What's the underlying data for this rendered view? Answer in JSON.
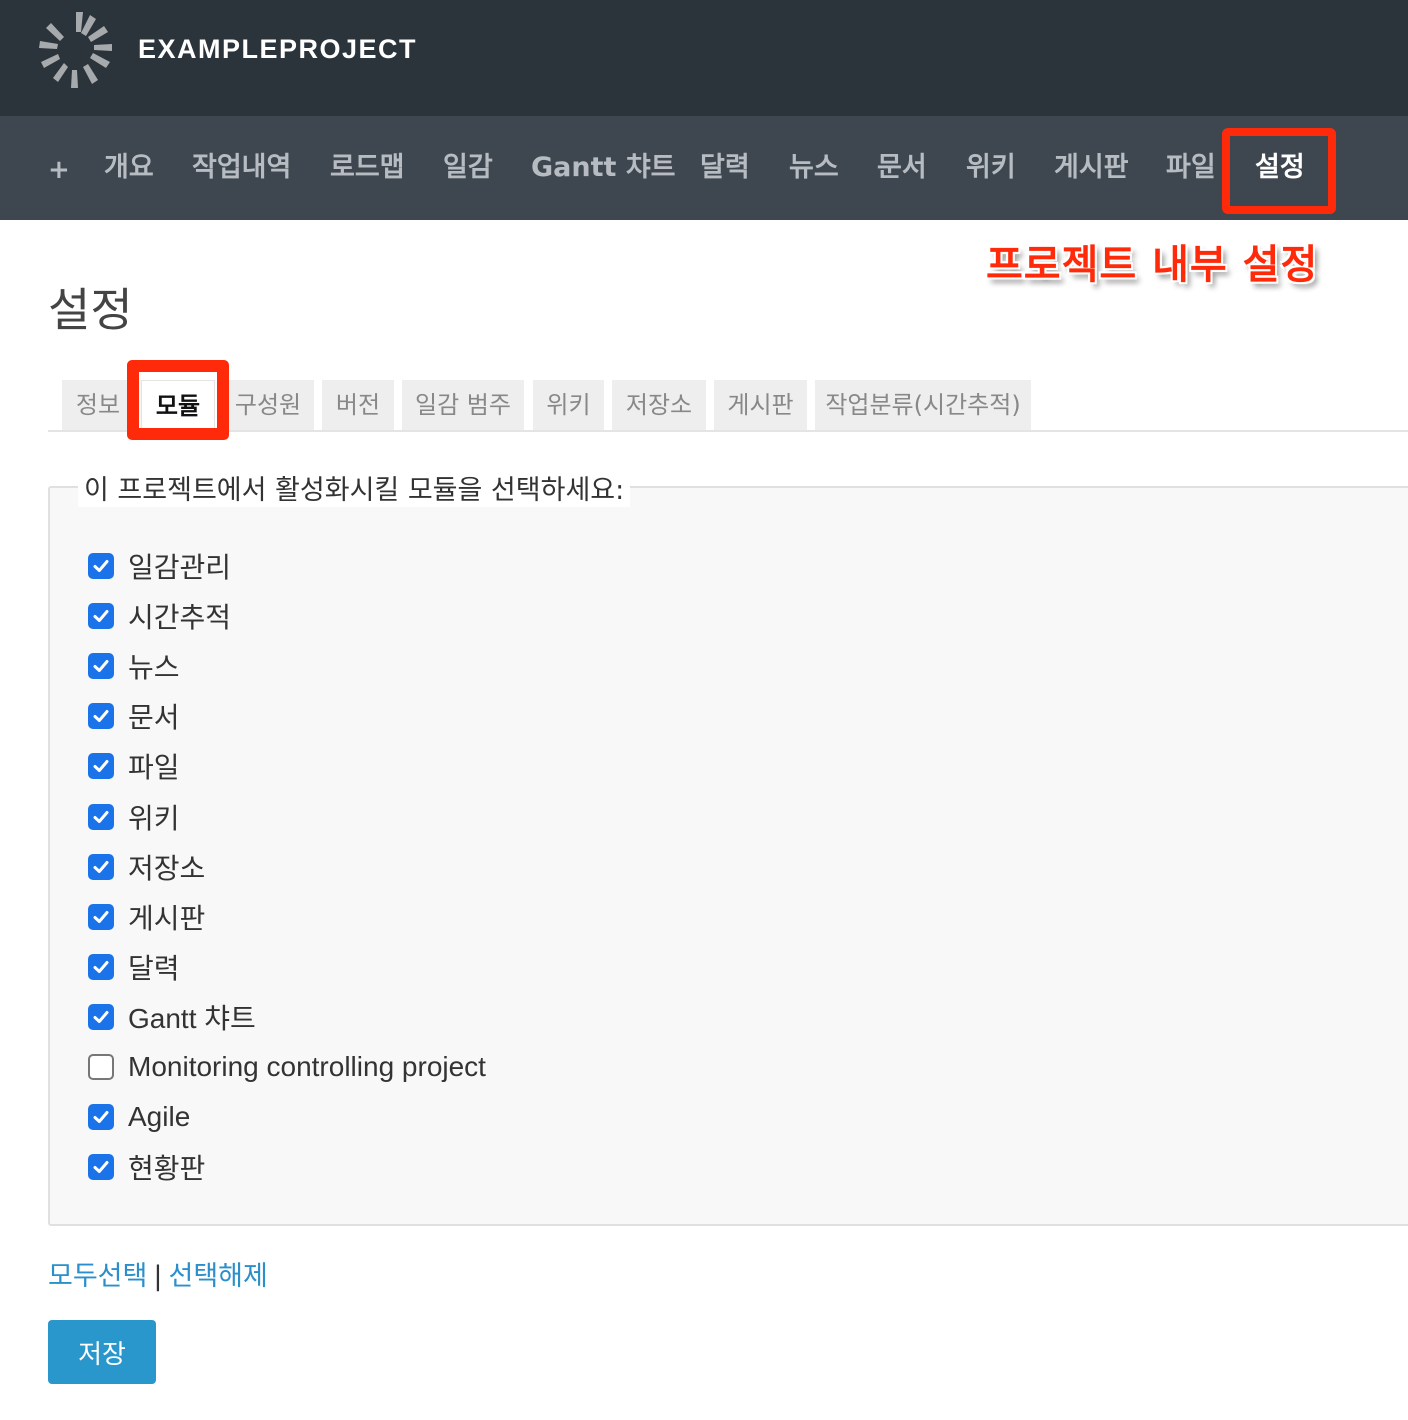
{
  "header": {
    "project_name": "EXAMPLEPROJECT",
    "logo_icon": "redmine-gear-logo-icon"
  },
  "main_menu": {
    "plus_label": "+",
    "items": [
      {
        "label": "개요"
      },
      {
        "label": "작업내역"
      },
      {
        "label": "로드맵"
      },
      {
        "label": "일감"
      },
      {
        "label": "Gantt 챠트"
      },
      {
        "label": "달력"
      },
      {
        "label": "뉴스"
      },
      {
        "label": "문서"
      },
      {
        "label": "위키"
      },
      {
        "label": "게시판"
      },
      {
        "label": "파일"
      },
      {
        "label": "설정",
        "selected": true
      }
    ]
  },
  "annotation": {
    "text": "프로젝트 내부 설정",
    "color": "#ff2a0a"
  },
  "page": {
    "title": "설정"
  },
  "tabs": [
    {
      "label": "정보"
    },
    {
      "label": "모듈",
      "active": true
    },
    {
      "label": "구성원"
    },
    {
      "label": "버전"
    },
    {
      "label": "일감 범주"
    },
    {
      "label": "위키"
    },
    {
      "label": "저장소"
    },
    {
      "label": "게시판"
    },
    {
      "label": "작업분류(시간추적)"
    }
  ],
  "modules": {
    "legend": "이 프로젝트에서 활성화시킬 모듈을 선택하세요:",
    "items": [
      {
        "label": "일감관리",
        "checked": true
      },
      {
        "label": "시간추적",
        "checked": true
      },
      {
        "label": "뉴스",
        "checked": true
      },
      {
        "label": "문서",
        "checked": true
      },
      {
        "label": "파일",
        "checked": true
      },
      {
        "label": "위키",
        "checked": true
      },
      {
        "label": "저장소",
        "checked": true
      },
      {
        "label": "게시판",
        "checked": true
      },
      {
        "label": "달력",
        "checked": true
      },
      {
        "label": "Gantt 챠트",
        "checked": true
      },
      {
        "label": "Monitoring controlling project",
        "checked": false
      },
      {
        "label": "Agile",
        "checked": true
      },
      {
        "label": "현황판",
        "checked": true
      }
    ]
  },
  "select_links": {
    "check_all": "모두선택",
    "separator": "|",
    "uncheck_all": "선택해제"
  },
  "save_button": {
    "label": "저장"
  },
  "colors": {
    "accent_link": "#2a8fcb",
    "save_button": "#2996cc",
    "checkbox": "#1a73e8",
    "highlight": "#ff2a0a"
  }
}
